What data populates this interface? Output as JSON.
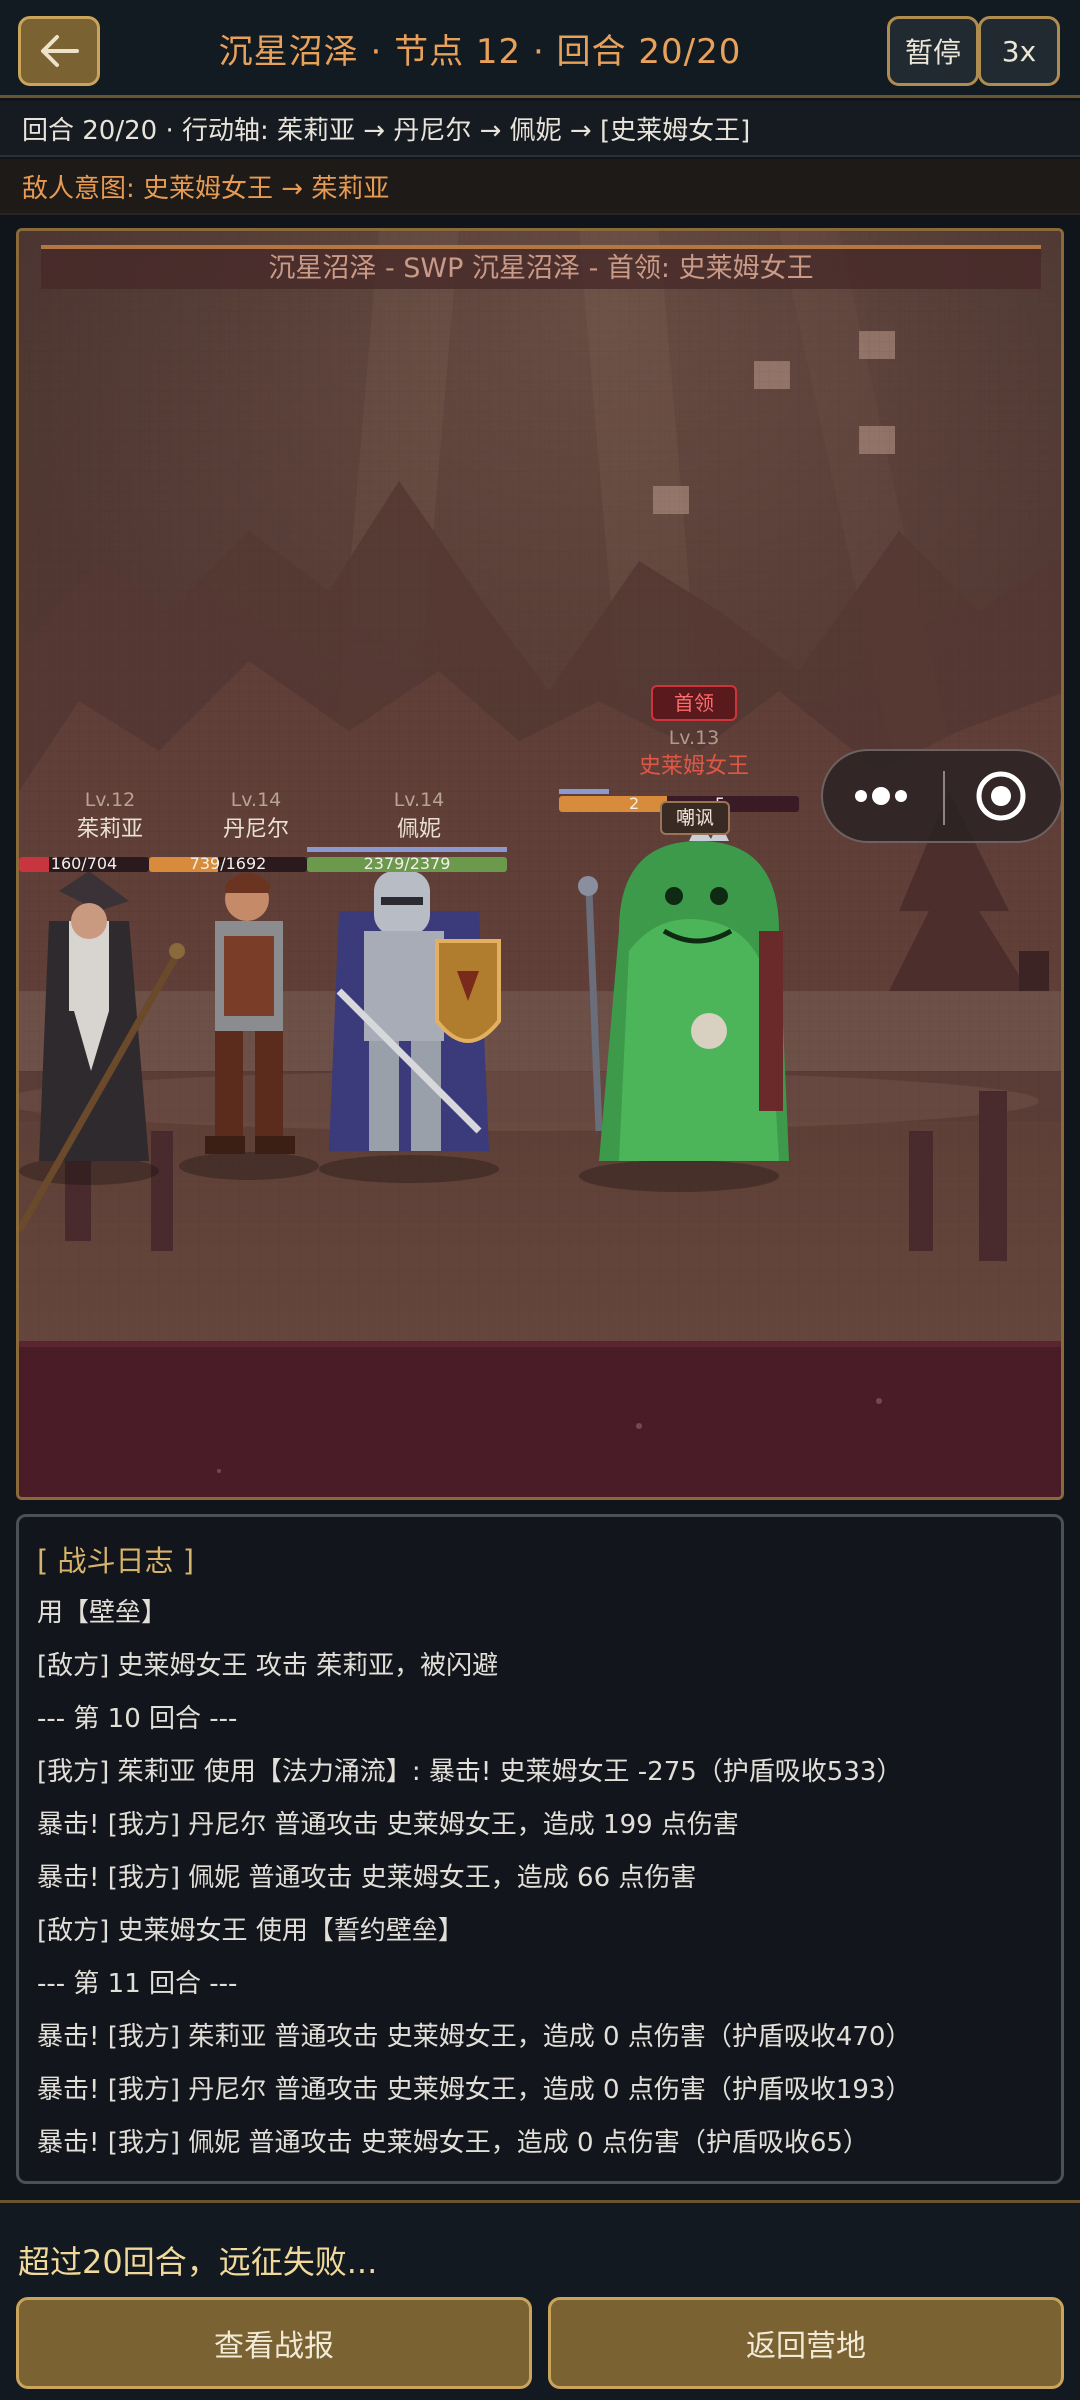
{
  "header": {
    "title": "沉星沼泽 · 节点 12 · 回合 20/20",
    "pause_label": "暂停",
    "speed_label": "3x"
  },
  "turn_info": "回合 20/20 · 行动轴: 茱莉亚 → 丹尼尔 → 佩妮 → [史莱姆女王]",
  "enemy_intent": "敌人意图: 史莱姆女王 → 茱莉亚",
  "scene": {
    "banner": "沉星沼泽 - SWP 沉星沼泽 - 首领: 史莱姆女王",
    "party": [
      {
        "level": "Lv.12",
        "name": "茱莉亚",
        "hp_text": "160/704",
        "hp_fraction": 0.227,
        "color": "#c8353f"
      },
      {
        "level": "Lv.14",
        "name": "丹尼尔",
        "hp_text": "739/1692",
        "hp_fraction": 0.437,
        "color": "#d88b3a"
      },
      {
        "level": "Lv.14",
        "name": "佩妮",
        "hp_text": "2379/2379",
        "hp_fraction": 1.0,
        "color": "#6b9a4d"
      }
    ],
    "boss": {
      "tag": "首领",
      "level": "Lv.13",
      "name": "史莱姆女王",
      "status": "嘲讽",
      "hp_text_left": "2",
      "hp_text_right": "5"
    }
  },
  "log": {
    "title": "[ 战斗日志 ]",
    "lines": [
      "用【壁垒】",
      "[敌方] 史莱姆女王 攻击 茱莉亚，被闪避",
      "--- 第 10 回合 ---",
      "[我方] 茱莉亚 使用【法力涌流】: 暴击! 史莱姆女王 -275（护盾吸收533）",
      "暴击! [我方] 丹尼尔 普通攻击 史莱姆女王，造成 199 点伤害",
      "暴击! [我方] 佩妮 普通攻击 史莱姆女王，造成 66 点伤害",
      "[敌方] 史莱姆女王 使用【誓约壁垒】",
      "--- 第 11 回合 ---",
      "暴击! [我方] 茱莉亚 普通攻击 史莱姆女王，造成 0 点伤害（护盾吸收470）",
      "暴击! [我方] 丹尼尔 普通攻击 史莱姆女王，造成 0 点伤害（护盾吸收193）",
      "暴击! [我方] 佩妮 普通攻击 史莱姆女王，造成 0 点伤害（护盾吸收65）"
    ]
  },
  "footer": {
    "result_text": "超过20回合，远征失败...",
    "report_button": "查看战报",
    "camp_button": "返回营地"
  }
}
